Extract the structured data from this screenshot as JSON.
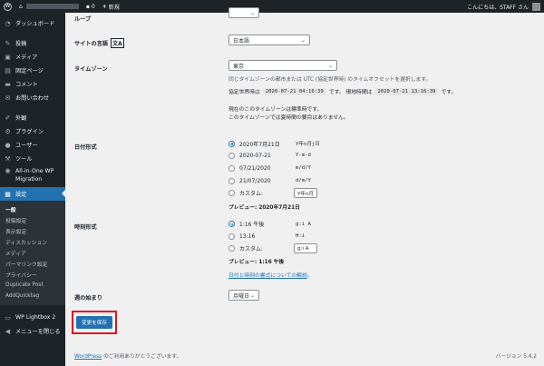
{
  "adminbar": {
    "comments_count": "0",
    "new_label": "新規",
    "greeting": "こんにちは、STAFF さん"
  },
  "sidebar": {
    "items": [
      {
        "label": "ダッシュボード",
        "icon": "dashboard-icon"
      },
      {
        "label": "投稿",
        "icon": "pin-icon"
      },
      {
        "label": "メディア",
        "icon": "media-icon"
      },
      {
        "label": "固定ページ",
        "icon": "page-icon"
      },
      {
        "label": "コメント",
        "icon": "comment-icon"
      },
      {
        "label": "お問い合わせ",
        "icon": "mail-icon"
      },
      {
        "label": "外観",
        "icon": "brush-icon"
      },
      {
        "label": "プラグイン",
        "icon": "plugin-icon"
      },
      {
        "label": "ユーザー",
        "icon": "user-icon"
      },
      {
        "label": "ツール",
        "icon": "wrench-icon"
      },
      {
        "label": "All-in-One WP Migration",
        "icon": "migration-icon"
      },
      {
        "label": "設定",
        "icon": "settings-icon"
      }
    ],
    "submenu": [
      "一般",
      "投稿設定",
      "表示設定",
      "ディスカッション",
      "メディア",
      "パーマリンク設定",
      "プライバシー",
      "Duplicate Post",
      "AddQuicktag"
    ],
    "lightbox": "WP Lightbox 2",
    "collapse": "メニューを閉じる"
  },
  "settings": {
    "site_language_label": "サイトの言語",
    "site_language_value": "日本語",
    "loop_label": "ループ",
    "timezone_label": "タイムゾーン",
    "timezone_value": "東京",
    "timezone_desc": "同じタイムゾーンの都市または UTC (協定世界時) のタイムオフセットを選択します。",
    "utc_prefix": "協定世界時は",
    "utc_time": "2020-07-21 04:16:39",
    "utc_suffix": "です。 現地時間は",
    "local_time": "2020-07-21 13:16:39",
    "local_suffix": "です。",
    "dst_line1": "現在のこのタイムゾーンは標準時です。",
    "dst_line2": "このタイムゾーンでは夏時間の要目はありません。",
    "date_format_label": "日付形式",
    "date_options": [
      {
        "label": "2020年7月21日",
        "format": "Y年n月j日",
        "checked": true
      },
      {
        "label": "2020-07-21",
        "format": "Y-m-d",
        "checked": false
      },
      {
        "label": "07/21/2020",
        "format": "m/d/Y",
        "checked": false
      },
      {
        "label": "21/07/2020",
        "format": "d/m/Y",
        "checked": false
      }
    ],
    "date_custom_label": "カスタム:",
    "date_custom_value": "Y年n月",
    "date_preview": "プレビュー: 2020年7月21日",
    "time_format_label": "時刻形式",
    "time_options": [
      {
        "label": "1:16 午後",
        "format": "g:i A",
        "checked": true
      },
      {
        "label": "13:16",
        "format": "H:i",
        "checked": false
      }
    ],
    "time_custom_label": "カスタム:",
    "time_custom_value": "g:i A",
    "time_preview": "プレビュー: 1:16 午後",
    "doc_link": "日付と時刻の書式についての解説",
    "week_start_label": "週の始まり",
    "week_start_value": "月曜日",
    "save_button": "変更を保存"
  },
  "footer": {
    "wp_link": "WordPress",
    "thanks": " のご利用ありがとうございます。",
    "version": "バージョン 5.4.2"
  },
  "colors": {
    "accent": "#2271b1",
    "highlight_box": "#e0141e",
    "sidebar_bg": "#1d2327"
  }
}
